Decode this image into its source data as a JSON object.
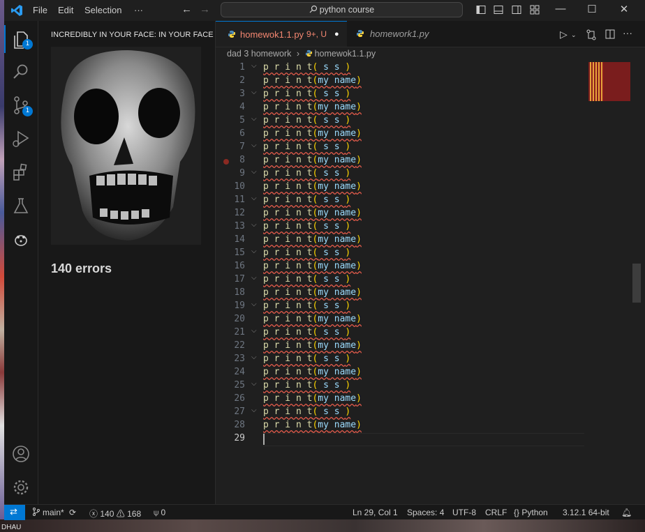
{
  "menu": [
    "File",
    "Edit",
    "Selection",
    "···"
  ],
  "command_center": {
    "search": "python course"
  },
  "window_controls": {
    "minimize": "—",
    "maximize": "☐",
    "close": "✕"
  },
  "activity": {
    "explorer_badge": "1",
    "scm_badge": "1"
  },
  "side_panel": {
    "title": "INCREDIBLY IN YOUR FACE: IN YOUR FACE",
    "errors_text": "140 errors"
  },
  "tabs": [
    {
      "label": "homewok1.1.py",
      "status": "9+, U",
      "modified_dot": "●",
      "active": true,
      "color": "#f48771"
    },
    {
      "label": "homework1.py",
      "active": false,
      "color": "#cccccc"
    }
  ],
  "breadcrumb": {
    "folder": "dad 3 homework",
    "sep": "›",
    "file": "homewok1.1.py"
  },
  "editor": {
    "lines": [
      {
        "n": "1",
        "fold": true,
        "kind": "ss"
      },
      {
        "n": "2",
        "fold": false,
        "kind": "name"
      },
      {
        "n": "3",
        "fold": true,
        "kind": "ss"
      },
      {
        "n": "4",
        "fold": false,
        "kind": "name"
      },
      {
        "n": "5",
        "fold": true,
        "kind": "ss"
      },
      {
        "n": "6",
        "fold": false,
        "kind": "name"
      },
      {
        "n": "7",
        "fold": true,
        "kind": "ss"
      },
      {
        "n": "8",
        "fold": false,
        "kind": "name"
      },
      {
        "n": "9",
        "fold": true,
        "kind": "ss"
      },
      {
        "n": "10",
        "fold": false,
        "kind": "name"
      },
      {
        "n": "11",
        "fold": true,
        "kind": "ss"
      },
      {
        "n": "12",
        "fold": false,
        "kind": "name"
      },
      {
        "n": "13",
        "fold": true,
        "kind": "ss"
      },
      {
        "n": "14",
        "fold": false,
        "kind": "name"
      },
      {
        "n": "15",
        "fold": true,
        "kind": "ss"
      },
      {
        "n": "16",
        "fold": false,
        "kind": "name"
      },
      {
        "n": "17",
        "fold": true,
        "kind": "ss"
      },
      {
        "n": "18",
        "fold": false,
        "kind": "name"
      },
      {
        "n": "19",
        "fold": true,
        "kind": "ss"
      },
      {
        "n": "20",
        "fold": false,
        "kind": "name"
      },
      {
        "n": "21",
        "fold": true,
        "kind": "ss"
      },
      {
        "n": "22",
        "fold": false,
        "kind": "name"
      },
      {
        "n": "23",
        "fold": true,
        "kind": "ss"
      },
      {
        "n": "24",
        "fold": false,
        "kind": "name"
      },
      {
        "n": "25",
        "fold": true,
        "kind": "ss"
      },
      {
        "n": "26",
        "fold": false,
        "kind": "name"
      },
      {
        "n": "27",
        "fold": true,
        "kind": "ss"
      },
      {
        "n": "28",
        "fold": false,
        "kind": "name"
      },
      {
        "n": "29",
        "fold": false,
        "kind": "empty"
      }
    ],
    "code_ss": {
      "fn": "p r i n t",
      "open": "(",
      "arg": " s s ",
      "close": ")"
    },
    "code_name": {
      "fn": "p r i n t",
      "open": "(",
      "arg1": "my",
      "arg2": " name",
      "close": ")"
    },
    "breakpoint_line": "8",
    "current_line": "29"
  },
  "status": {
    "branch": "main*",
    "errors": "140",
    "warnings": "168",
    "ports": "0",
    "position": "Ln 29, Col 1",
    "spaces": "Spaces: 4",
    "encoding": "UTF-8",
    "eol": "CRLF",
    "language": "Python",
    "interpreter": "3.12.1 64-bit"
  },
  "desktop": {
    "bottom_text": "DHAU"
  },
  "colors": {
    "accent": "#0078d4",
    "error_tab": "#f48771",
    "squiggle": "#e05a4a",
    "function": "#dcdcaa",
    "bracket": "#ffd700"
  }
}
